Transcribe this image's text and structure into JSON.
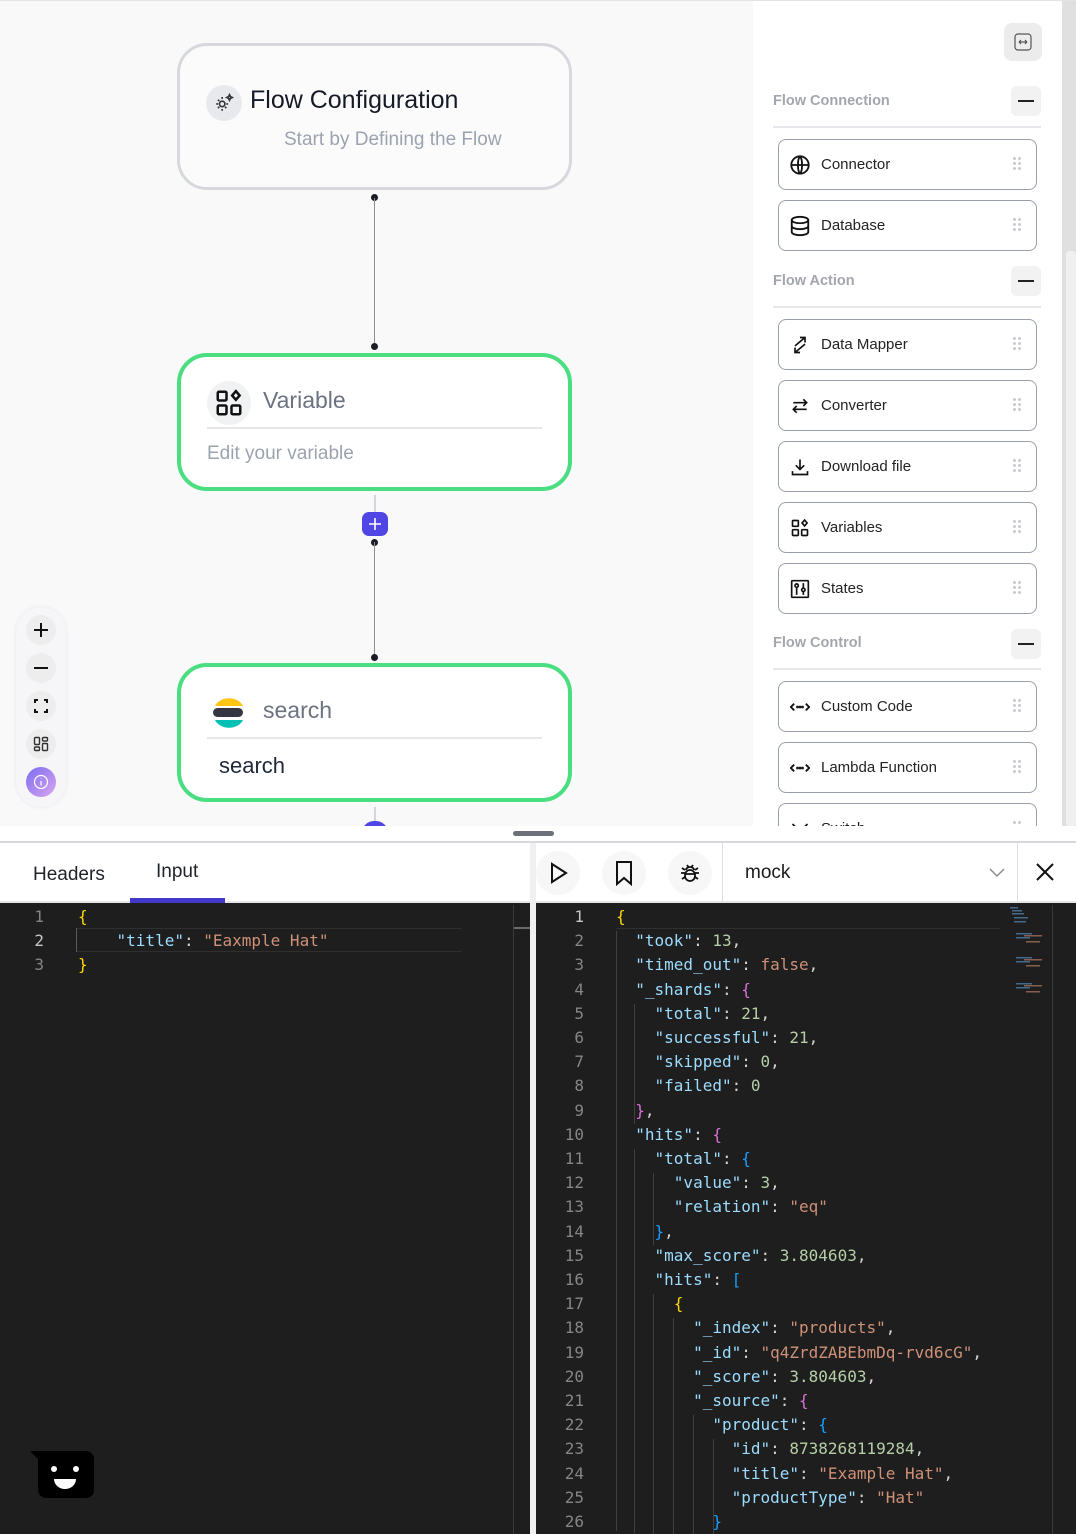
{
  "canvas": {
    "nodes": {
      "config": {
        "title": "Flow Configuration",
        "subtitle": "Start by Defining the Flow",
        "icon": "gear-sparkle-icon"
      },
      "variable": {
        "title": "Variable",
        "body": "Edit your variable",
        "icon": "variables-icon"
      },
      "search": {
        "title": "search",
        "body": "search",
        "icon": "elasticsearch-logo-icon"
      }
    },
    "zoom_controls": [
      "zoom-in",
      "zoom-out",
      "fit-view",
      "layout",
      "info"
    ]
  },
  "panel": {
    "expand_icon": "expand-horizontal-icon",
    "sections": [
      {
        "title": "Flow Connection",
        "items": [
          {
            "label": "Connector",
            "icon": "globe-icon"
          },
          {
            "label": "Database",
            "icon": "database-icon"
          }
        ]
      },
      {
        "title": "Flow Action",
        "items": [
          {
            "label": "Data Mapper",
            "icon": "arrows-diagonal-icon"
          },
          {
            "label": "Converter",
            "icon": "arrows-swap-icon"
          },
          {
            "label": "Download file",
            "icon": "download-icon"
          },
          {
            "label": "Variables",
            "icon": "variables-icon"
          },
          {
            "label": "States",
            "icon": "sliders-icon"
          }
        ]
      },
      {
        "title": "Flow Control",
        "items": [
          {
            "label": "Custom Code",
            "icon": "code-icon"
          },
          {
            "label": "Lambda Function",
            "icon": "code-icon"
          },
          {
            "label": "Switch",
            "icon": "switch-icon"
          }
        ]
      }
    ]
  },
  "bottom_left": {
    "tabs": [
      {
        "label": "Headers",
        "active": false
      },
      {
        "label": "Input",
        "active": true
      }
    ],
    "editor_lines": [
      {
        "num": "1",
        "tokens": [
          [
            "b1",
            "{"
          ]
        ]
      },
      {
        "num": "2",
        "tokens": [
          [
            "p",
            "    "
          ],
          [
            "k",
            "\"title\""
          ],
          [
            "p",
            ": "
          ],
          [
            "s",
            "\"Eaxmple Hat\""
          ]
        ]
      },
      {
        "num": "3",
        "tokens": [
          [
            "b1",
            "}"
          ]
        ]
      }
    ]
  },
  "bottom_right": {
    "toolbar": {
      "run_icon": "play-icon",
      "save_icon": "bookmark-icon",
      "debug_icon": "bug-icon",
      "environment": "mock",
      "close_icon": "close-icon"
    },
    "editor_lines": [
      {
        "num": "1",
        "tokens": [
          [
            "b1",
            "{"
          ]
        ]
      },
      {
        "num": "2",
        "tokens": [
          [
            "p",
            "  "
          ],
          [
            "k",
            "\"took\""
          ],
          [
            "p",
            ": "
          ],
          [
            "n",
            "13"
          ],
          [
            "p",
            ","
          ]
        ]
      },
      {
        "num": "3",
        "tokens": [
          [
            "p",
            "  "
          ],
          [
            "k",
            "\"timed_out\""
          ],
          [
            "p",
            ": "
          ],
          [
            "s",
            "false"
          ],
          [
            "p",
            ","
          ]
        ]
      },
      {
        "num": "4",
        "tokens": [
          [
            "p",
            "  "
          ],
          [
            "k",
            "\"_shards\""
          ],
          [
            "p",
            ": "
          ],
          [
            "b2",
            "{"
          ]
        ]
      },
      {
        "num": "5",
        "tokens": [
          [
            "p",
            "    "
          ],
          [
            "k",
            "\"total\""
          ],
          [
            "p",
            ": "
          ],
          [
            "n",
            "21"
          ],
          [
            "p",
            ","
          ]
        ]
      },
      {
        "num": "6",
        "tokens": [
          [
            "p",
            "    "
          ],
          [
            "k",
            "\"successful\""
          ],
          [
            "p",
            ": "
          ],
          [
            "n",
            "21"
          ],
          [
            "p",
            ","
          ]
        ]
      },
      {
        "num": "7",
        "tokens": [
          [
            "p",
            "    "
          ],
          [
            "k",
            "\"skipped\""
          ],
          [
            "p",
            ": "
          ],
          [
            "n",
            "0"
          ],
          [
            "p",
            ","
          ]
        ]
      },
      {
        "num": "8",
        "tokens": [
          [
            "p",
            "    "
          ],
          [
            "k",
            "\"failed\""
          ],
          [
            "p",
            ": "
          ],
          [
            "n",
            "0"
          ]
        ]
      },
      {
        "num": "9",
        "tokens": [
          [
            "p",
            "  "
          ],
          [
            "b2",
            "}"
          ],
          [
            "p",
            ","
          ]
        ]
      },
      {
        "num": "10",
        "tokens": [
          [
            "p",
            "  "
          ],
          [
            "k",
            "\"hits\""
          ],
          [
            "p",
            ": "
          ],
          [
            "b2",
            "{"
          ]
        ]
      },
      {
        "num": "11",
        "tokens": [
          [
            "p",
            "    "
          ],
          [
            "k",
            "\"total\""
          ],
          [
            "p",
            ": "
          ],
          [
            "b3",
            "{"
          ]
        ]
      },
      {
        "num": "12",
        "tokens": [
          [
            "p",
            "      "
          ],
          [
            "k",
            "\"value\""
          ],
          [
            "p",
            ": "
          ],
          [
            "n",
            "3"
          ],
          [
            "p",
            ","
          ]
        ]
      },
      {
        "num": "13",
        "tokens": [
          [
            "p",
            "      "
          ],
          [
            "k",
            "\"relation\""
          ],
          [
            "p",
            ": "
          ],
          [
            "s",
            "\"eq\""
          ]
        ]
      },
      {
        "num": "14",
        "tokens": [
          [
            "p",
            "    "
          ],
          [
            "b3",
            "}"
          ],
          [
            "p",
            ","
          ]
        ]
      },
      {
        "num": "15",
        "tokens": [
          [
            "p",
            "    "
          ],
          [
            "k",
            "\"max_score\""
          ],
          [
            "p",
            ": "
          ],
          [
            "n",
            "3.804603"
          ],
          [
            "p",
            ","
          ]
        ]
      },
      {
        "num": "16",
        "tokens": [
          [
            "p",
            "    "
          ],
          [
            "k",
            "\"hits\""
          ],
          [
            "p",
            ": "
          ],
          [
            "b3",
            "["
          ]
        ]
      },
      {
        "num": "17",
        "tokens": [
          [
            "p",
            "      "
          ],
          [
            "b1",
            "{"
          ]
        ]
      },
      {
        "num": "18",
        "tokens": [
          [
            "p",
            "        "
          ],
          [
            "k",
            "\"_index\""
          ],
          [
            "p",
            ": "
          ],
          [
            "s",
            "\"products\""
          ],
          [
            "p",
            ","
          ]
        ]
      },
      {
        "num": "19",
        "tokens": [
          [
            "p",
            "        "
          ],
          [
            "k",
            "\"_id\""
          ],
          [
            "p",
            ": "
          ],
          [
            "s",
            "\"q4ZrdZABEbmDq-rvd6cG\""
          ],
          [
            "p",
            ","
          ]
        ]
      },
      {
        "num": "20",
        "tokens": [
          [
            "p",
            "        "
          ],
          [
            "k",
            "\"_score\""
          ],
          [
            "p",
            ": "
          ],
          [
            "n",
            "3.804603"
          ],
          [
            "p",
            ","
          ]
        ]
      },
      {
        "num": "21",
        "tokens": [
          [
            "p",
            "        "
          ],
          [
            "k",
            "\"_source\""
          ],
          [
            "p",
            ": "
          ],
          [
            "b2",
            "{"
          ]
        ]
      },
      {
        "num": "22",
        "tokens": [
          [
            "p",
            "          "
          ],
          [
            "k",
            "\"product\""
          ],
          [
            "p",
            ": "
          ],
          [
            "b3",
            "{"
          ]
        ]
      },
      {
        "num": "23",
        "tokens": [
          [
            "p",
            "            "
          ],
          [
            "k",
            "\"id\""
          ],
          [
            "p",
            ": "
          ],
          [
            "n",
            "8738268119284"
          ],
          [
            "p",
            ","
          ]
        ]
      },
      {
        "num": "24",
        "tokens": [
          [
            "p",
            "            "
          ],
          [
            "k",
            "\"title\""
          ],
          [
            "p",
            ": "
          ],
          [
            "s",
            "\"Example Hat\""
          ],
          [
            "p",
            ","
          ]
        ]
      },
      {
        "num": "25",
        "tokens": [
          [
            "p",
            "            "
          ],
          [
            "k",
            "\"productType\""
          ],
          [
            "p",
            ": "
          ],
          [
            "s",
            "\"Hat\""
          ]
        ]
      },
      {
        "num": "26",
        "tokens": [
          [
            "p",
            "          "
          ],
          [
            "b3",
            "}"
          ]
        ]
      }
    ]
  },
  "chat_widget": {
    "icon": "chat-smiley-icon"
  }
}
